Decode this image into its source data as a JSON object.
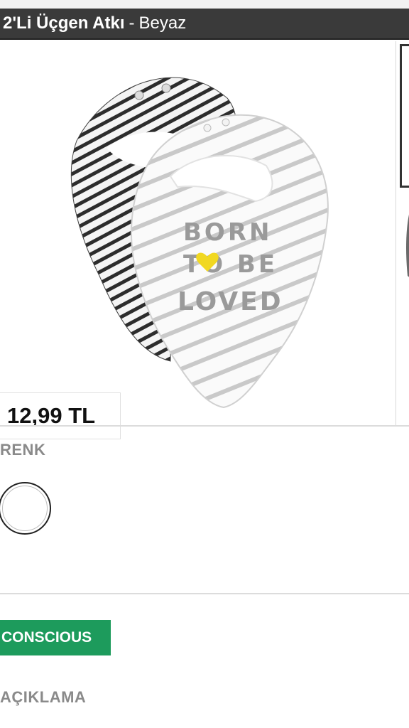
{
  "product": {
    "name": "2'Li Üçgen Atkı",
    "separator": "-",
    "color_name": "Beyaz",
    "price": "12,99 TL",
    "image_text": [
      "BORN",
      "TO BE",
      "LOVED"
    ]
  },
  "color_section": {
    "label": "RENK",
    "selected_swatch_color": "#ffffff"
  },
  "badge": {
    "label": "CONSCIOUS",
    "color": "#1d9b5c"
  },
  "description_section": {
    "label": "AÇIKLAMA"
  },
  "colors": {
    "title_bar": "#3a3a3a",
    "section_label": "#8a8a8a"
  }
}
